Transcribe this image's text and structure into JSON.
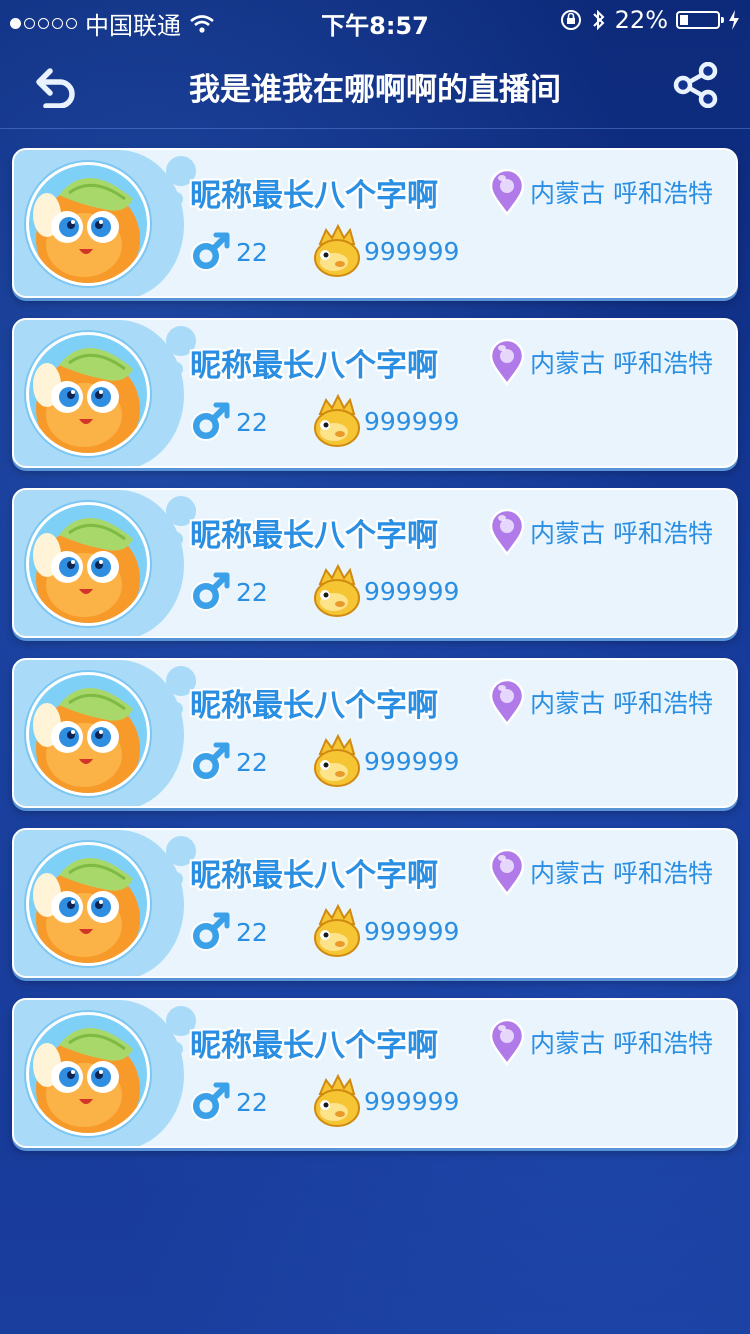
{
  "status_bar": {
    "carrier": "中国联通",
    "time": "下午8:57",
    "battery": "22%",
    "battery_level": 0.22
  },
  "nav": {
    "title": "我是谁我在哪啊啊的直播间",
    "back_icon": "back-arrow-icon",
    "share_icon": "share-icon"
  },
  "viewers": [
    {
      "nickname": "昵称最长八个字啊",
      "location": "内蒙古 呼和浩特",
      "age": "22",
      "coins": "999999"
    },
    {
      "nickname": "昵称最长八个字啊",
      "location": "内蒙古 呼和浩特",
      "age": "22",
      "coins": "999999"
    },
    {
      "nickname": "昵称最长八个字啊",
      "location": "内蒙古 呼和浩特",
      "age": "22",
      "coins": "999999"
    },
    {
      "nickname": "昵称最长八个字啊",
      "location": "内蒙古 呼和浩特",
      "age": "22",
      "coins": "999999"
    },
    {
      "nickname": "昵称最长八个字啊",
      "location": "内蒙古 呼和浩特",
      "age": "22",
      "coins": "999999"
    },
    {
      "nickname": "昵称最长八个字啊",
      "location": "内蒙古 呼和浩特",
      "age": "22",
      "coins": "999999"
    }
  ],
  "colors": {
    "accent": "#2a8fe3",
    "card_bg": "#e9f4fd",
    "location_pin": "#b07be8",
    "gender_icon": "#3aa0e8",
    "coin_icon": "#f6c534"
  }
}
